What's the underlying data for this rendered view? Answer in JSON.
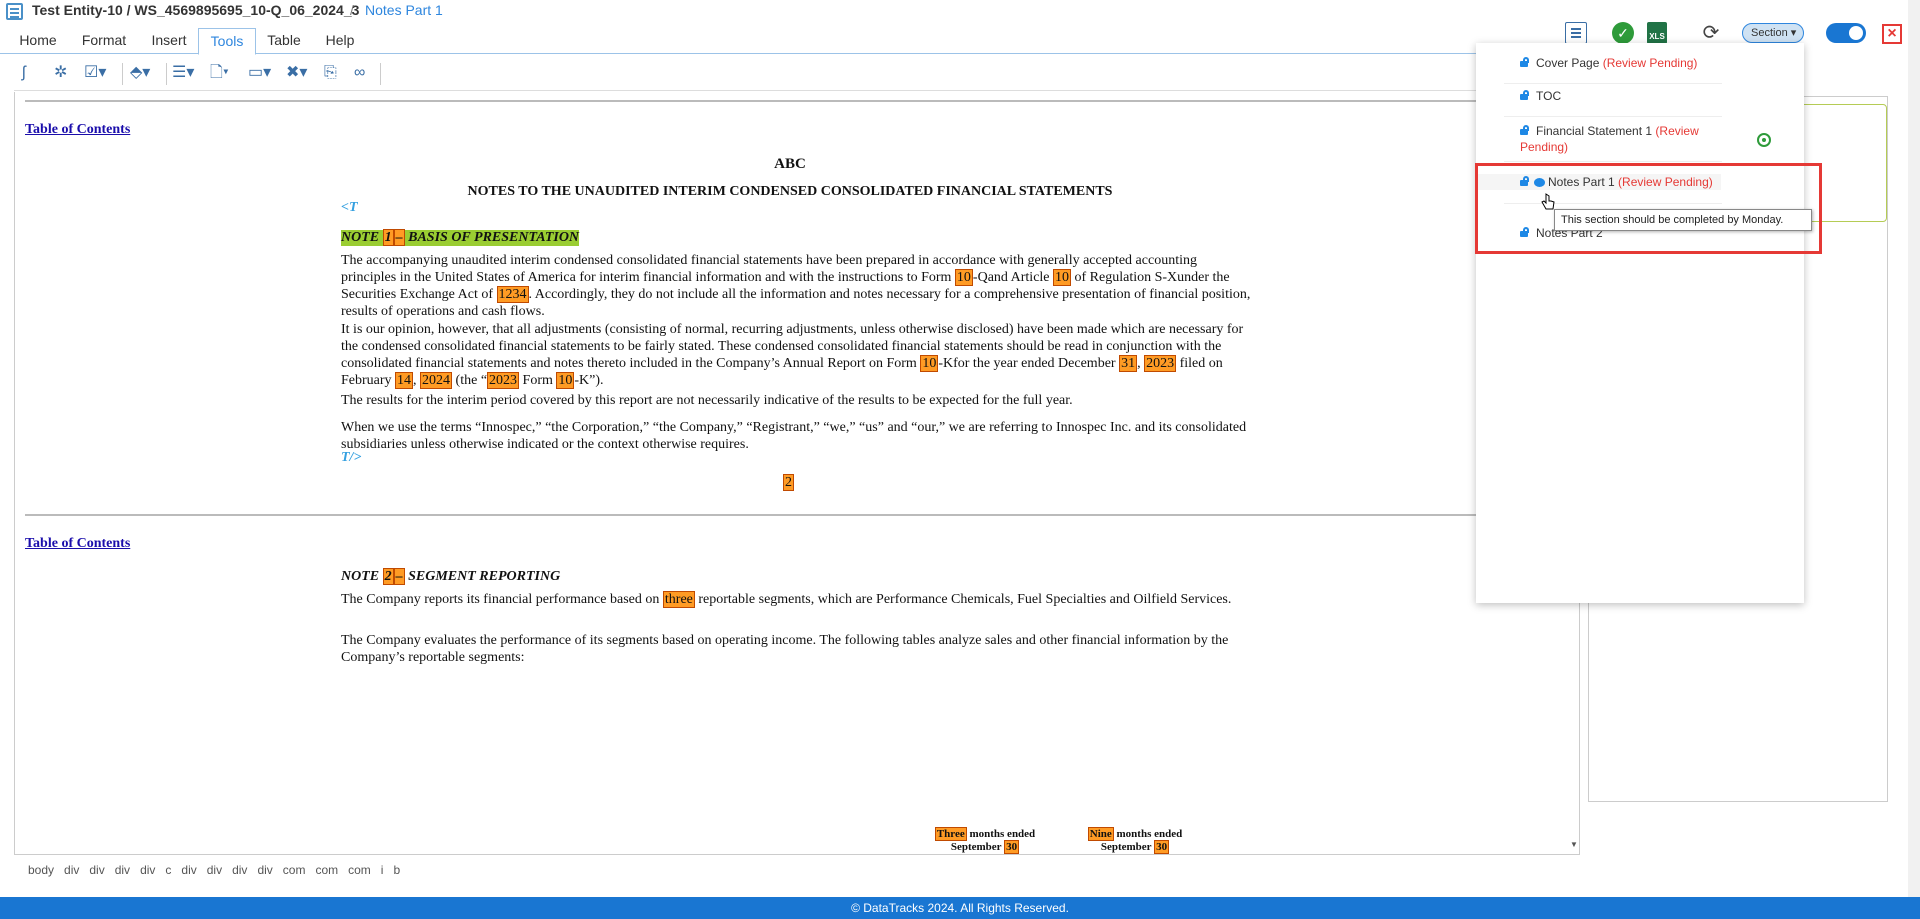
{
  "titlebar": {
    "entity_path": "Test Entity-10 / WS_4569895695_10-Q_06_2024_3",
    "separator": "/",
    "current_section": "Notes Part 1"
  },
  "menu": {
    "tabs": [
      "Home",
      "Format",
      "Insert",
      "Tools",
      "Table",
      "Help"
    ],
    "active": "Tools"
  },
  "document": {
    "toc_link": "Table of Contents",
    "company": "ABC",
    "heading": "NOTES TO THE UNAUDITED INTERIM CONDENSED CONSOLIDATED FINANCIAL STATEMENTS",
    "t_open": "<T",
    "t_close": "T/>",
    "note1": {
      "pre": "NOTE ",
      "num": "1",
      "dash": "–",
      "title": " BASIS OF PRESENTATION"
    },
    "p1": {
      "a": "The accompanying unaudited interim condensed consolidated financial statements have been prepared in accordance with generally accepted accounting principles in the United States of America for interim financial information and with the instructions to Form ",
      "h1": "10",
      "b": "-Qand Article ",
      "h2": "10",
      "c": " of Regulation S-Xunder the Securities Exchange Act of ",
      "h3": "1234",
      "d": ". Accordingly, they do not include all the information and notes necessary for a comprehensive presentation of financial position, results of operations and cash flows."
    },
    "p2": {
      "a": "It is our opinion, however, that all adjustments (consisting of normal, recurring adjustments, unless otherwise disclosed) have been made which are necessary for the condensed consolidated financial statements to be fairly stated. These condensed consolidated financial statements should be read in conjunction with the consolidated financial statements and notes thereto included in the Company’s Annual Report on Form ",
      "h1": "10",
      "b": "-Kfor the year ended December ",
      "h2": "31",
      "c": ", ",
      "h3": "2023",
      "d": " filed on February ",
      "h4": "14",
      "e": ", ",
      "h5": "2024",
      "f": " (the “",
      "h6": "2023",
      "g": " Form ",
      "h7": "10",
      "i": "-K”)."
    },
    "p3": "The results for the interim period covered by this report are not necessarily indicative of the results to be expected for the full year.",
    "p4": "When we use the terms “Innospec,” “the Corporation,” “the Company,” “Registrant,” “we,” “us” and “our,” we are referring to Innospec Inc. and its consolidated subsidiaries unless otherwise indicated or the context otherwise requires.",
    "page_number": "2",
    "note2": {
      "pre": "NOTE ",
      "num": "2",
      "dash": "–",
      "title": " SEGMENT REPORTING"
    },
    "p5": {
      "a": "The Company reports its financial performance based on ",
      "h1": "three",
      "b": " reportable segments, which are Performance Chemicals, Fuel Specialties and Oilfield Services."
    },
    "p6": "The Company evaluates the performance of its segments based on operating income. The following tables analyze sales and other financial information by the Company’s reportable segments:",
    "col1": {
      "h": "Three",
      "a": " months ended",
      "b": "September ",
      "h2": "30"
    },
    "col2": {
      "h": "Nine",
      "a": " months ended",
      "b": "September ",
      "h2": "30"
    }
  },
  "pathbar": [
    "body",
    "div",
    "div",
    "div",
    "div",
    "c",
    "div",
    "div",
    "div",
    "div",
    "com",
    "com",
    "com",
    "i",
    "b"
  ],
  "footer": "© DataTracks 2024. All Rights Reserved.",
  "controls": {
    "section_dropdown": "Section",
    "xls_label": "XLS"
  },
  "sections": [
    {
      "name": "Cover Page",
      "status": "(Review Pending)"
    },
    {
      "name": "TOC",
      "status": ""
    },
    {
      "name": "Financial Statement 1",
      "status": "(Review Pending)"
    },
    {
      "name": "Notes Part 1",
      "status": "(Review Pending)"
    },
    {
      "name": "Notes Part 2",
      "status": ""
    }
  ],
  "tooltip": "This section should be completed by Monday.",
  "colors": {
    "accent": "#1976d2",
    "highlight": "#ff9b24",
    "pending": "#e53935",
    "note_green": "#9acd32"
  }
}
